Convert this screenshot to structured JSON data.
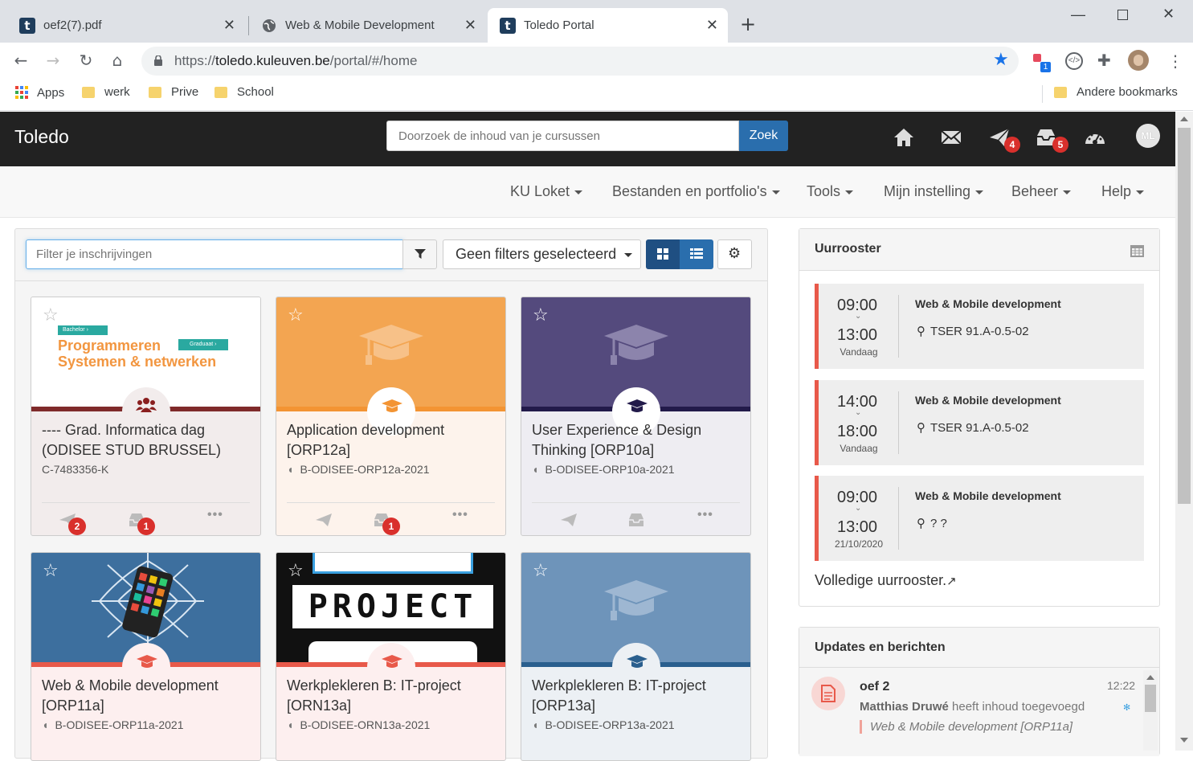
{
  "browser": {
    "tabs": [
      {
        "title": "oef2(7).pdf",
        "icon": "t"
      },
      {
        "title": "Web & Mobile Development",
        "icon": "globe-icon"
      },
      {
        "title": "Toledo Portal",
        "icon": "t"
      }
    ],
    "url_prefix": "https://",
    "url_host": "toledo.kuleuven.be",
    "url_path": "/portal/#/home",
    "bookmarks": [
      "Apps",
      "werk",
      "Prive",
      "School"
    ],
    "other_bookmarks": "Andere bookmarks",
    "extension_badge": "1"
  },
  "header": {
    "logo": "Toledo",
    "search_placeholder": "Doorzoek de inhoud van je cursussen",
    "search_button": "Zoek",
    "announcements_badge": "4",
    "inbox_badge": "5",
    "avatar_initials": "ML"
  },
  "menu": [
    "KU Loket",
    "Bestanden en portfolio's",
    "Tools",
    "Mijn instelling",
    "Beheer",
    "Help"
  ],
  "filters": {
    "placeholder": "Filter je inschrijvingen",
    "dropdown": "Geen filters geselecteerd"
  },
  "courses": [
    {
      "title": "---- Grad. Informatica dag (ODISEE STUD BRUSSEL)",
      "code": "C-7483356-K",
      "banner_line1": "Programmeren",
      "banner_line2": "Systemen & netwerken",
      "tag1": "Bachelor ›",
      "tag2": "Graduaat ›",
      "badge_announce": "2",
      "badge_inbox": "1"
    },
    {
      "title": "Application development [ORP12a]",
      "code": "B-ODISEE-ORP12a-2021",
      "badge_inbox": "1"
    },
    {
      "title": "User Experience & Design Thinking [ORP10a]",
      "code": "B-ODISEE-ORP10a-2021"
    },
    {
      "title": "Web & Mobile development [ORP11a]",
      "code": "B-ODISEE-ORP11a-2021"
    },
    {
      "title": "Werkplekleren B: IT-project [ORN13a]",
      "code": "B-ODISEE-ORN13a-2021",
      "banner_text": "PROJECT"
    },
    {
      "title": "Werkplekleren B: IT-project [ORP13a]",
      "code": "B-ODISEE-ORP13a-2021"
    }
  ],
  "schedule": {
    "title": "Uurrooster",
    "items": [
      {
        "start": "09:00",
        "end": "13:00",
        "day": "Vandaag",
        "course": "Web & Mobile development",
        "location": "TSER 91.A-0.5-02"
      },
      {
        "start": "14:00",
        "end": "18:00",
        "day": "Vandaag",
        "course": "Web & Mobile development",
        "location": "TSER 91.A-0.5-02"
      },
      {
        "start": "09:00",
        "end": "13:00",
        "day": "21/10/2020",
        "course": "Web & Mobile development",
        "location": "? ?"
      }
    ],
    "full_link": "Volledige uurrooster."
  },
  "updates": {
    "title": "Updates en berichten",
    "items": [
      {
        "title": "oef 2",
        "time": "12:22",
        "author": "Matthias Druwé",
        "action": " heeft inhoud toegevoegd",
        "course": "Web & Mobile development [ORP11a]"
      }
    ]
  },
  "colors": {
    "accent": "#2a6ead",
    "header_bg": "#222222",
    "badge": "#d9302c",
    "schedule_border": "#e8594a"
  }
}
